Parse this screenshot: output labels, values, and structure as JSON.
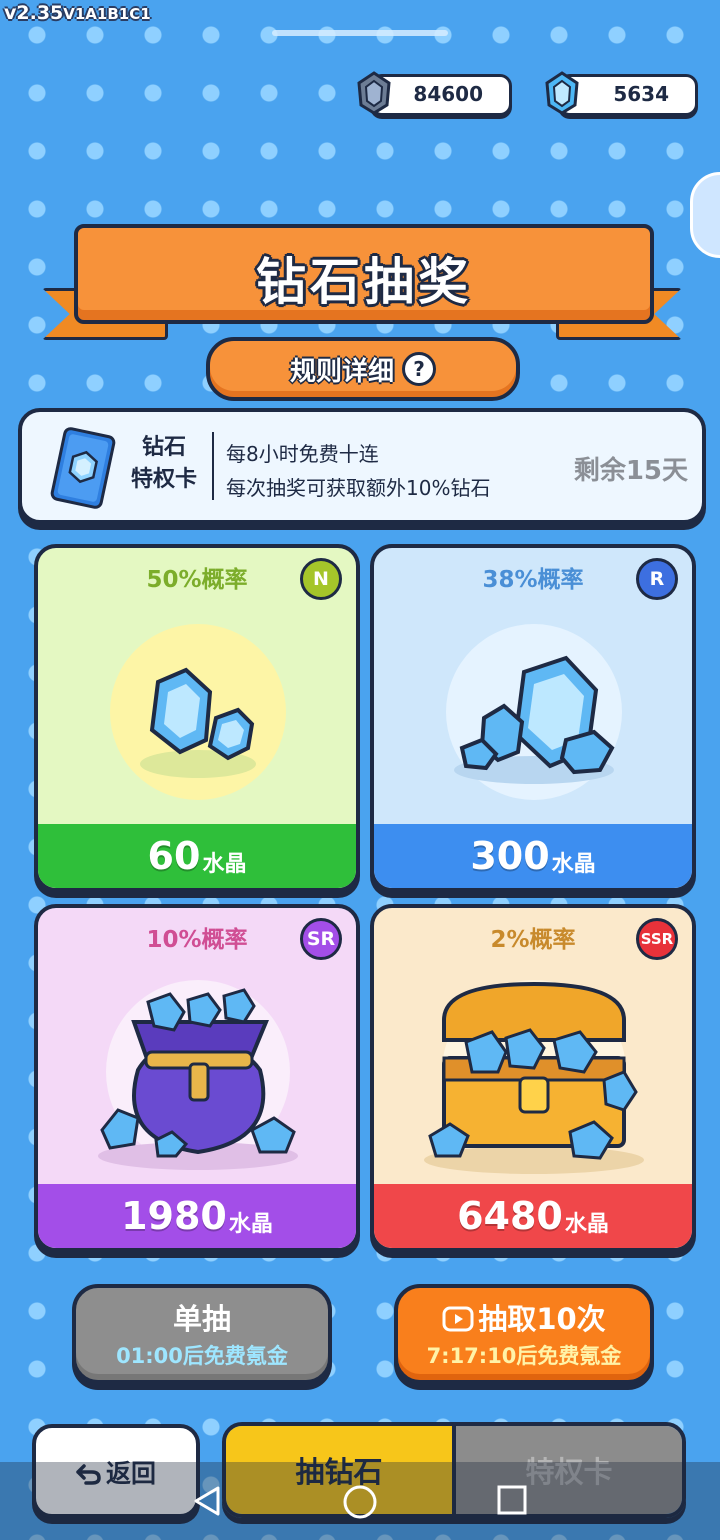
{
  "version": {
    "main": "v2.35",
    "build": "V1A1B1C1"
  },
  "currencies": [
    {
      "icon": "crystal-dark-icon",
      "value": "84600"
    },
    {
      "icon": "crystal-blue-icon",
      "value": "5634"
    }
  ],
  "title": "钻石抽奖",
  "rules_button": {
    "label": "规则详细",
    "icon": "question-icon"
  },
  "privilege": {
    "name_line1": "钻石",
    "name_line2": "特权卡",
    "benefit1": "每8小时免费十连",
    "benefit2": "每次抽奖可获取额外10%钻石",
    "remaining": "剩余15天"
  },
  "rewards": [
    {
      "prob": "50%概率",
      "rarity": "N",
      "amount": "60",
      "unit": "水晶",
      "color": "#2fbf3a"
    },
    {
      "prob": "38%概率",
      "rarity": "R",
      "amount": "300",
      "unit": "水晶",
      "color": "#3d8ef0"
    },
    {
      "prob": "10%概率",
      "rarity": "SR",
      "amount": "1980",
      "unit": "水晶",
      "color": "#a34ee8"
    },
    {
      "prob": "2%概率",
      "rarity": "SSR",
      "amount": "6480",
      "unit": "水晶",
      "color": "#f0474a"
    }
  ],
  "actions": {
    "single": {
      "label": "单抽",
      "sub": "01:00后免费氪金"
    },
    "ten": {
      "label": "抽取10次",
      "sub": "7:17:10后免费氪金"
    }
  },
  "nav": {
    "back": "返回",
    "tab_diamond": "抽钻石",
    "tab_privilege": "特权卡"
  }
}
